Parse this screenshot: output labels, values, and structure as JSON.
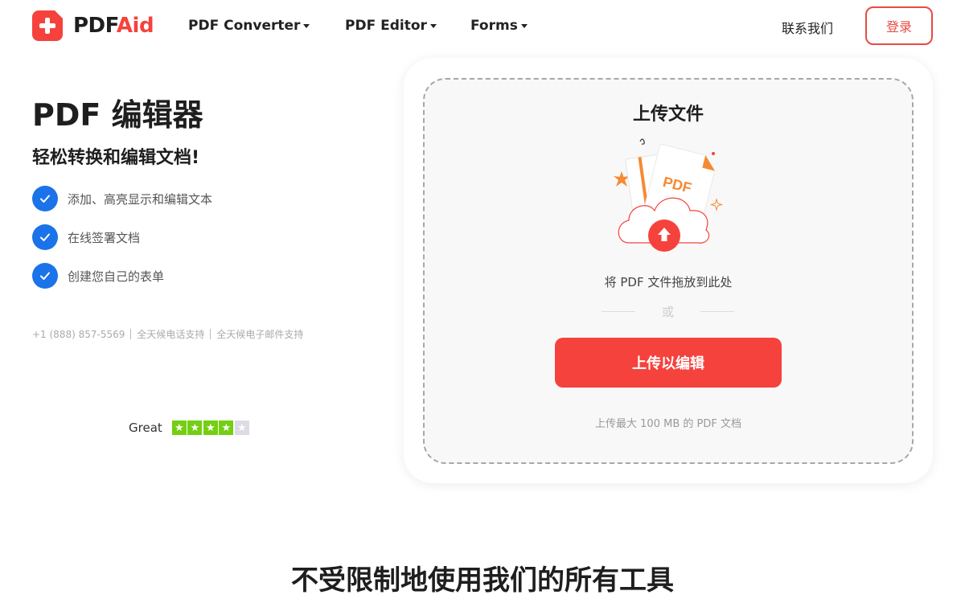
{
  "header": {
    "logo": {
      "text_dark": "PDF",
      "text_accent": "Aid"
    },
    "nav": [
      {
        "label": "PDF Converter"
      },
      {
        "label": "PDF Editor"
      },
      {
        "label": "Forms"
      }
    ],
    "contact_label": "联系我们",
    "login_label": "登录"
  },
  "hero": {
    "title": "PDF 编辑器",
    "subtitle": "轻松转换和编辑文档!",
    "features": [
      {
        "text": "添加、高亮显示和编辑文本"
      },
      {
        "text": "在线签署文档"
      },
      {
        "text": "创建您自己的表单"
      }
    ],
    "support": {
      "phone": "+1 (888) 857-5569",
      "phone_support": "全天候电话支持",
      "email_support": "全天候电子邮件支持"
    },
    "rating": {
      "label": "Great",
      "stars": 4,
      "max_stars": 5
    }
  },
  "upload": {
    "title": "上传文件",
    "illustration_label": "PDF",
    "drop_hint": "将 PDF 文件拖放到此处",
    "or_label": "或",
    "button_label": "上传以编辑",
    "size_note": "上传最大 100 MB 的 PDF 文档"
  },
  "section": {
    "title": "不受限制地使用我们的所有工具"
  },
  "colors": {
    "brand_red": "#f5423d",
    "check_blue": "#1a73e8",
    "star_green": "#73cf11",
    "illustration_orange": "#f58a33"
  },
  "icons": {
    "check": "check-icon",
    "upload": "upload-arrow-icon",
    "caret": "caret-down-icon"
  }
}
